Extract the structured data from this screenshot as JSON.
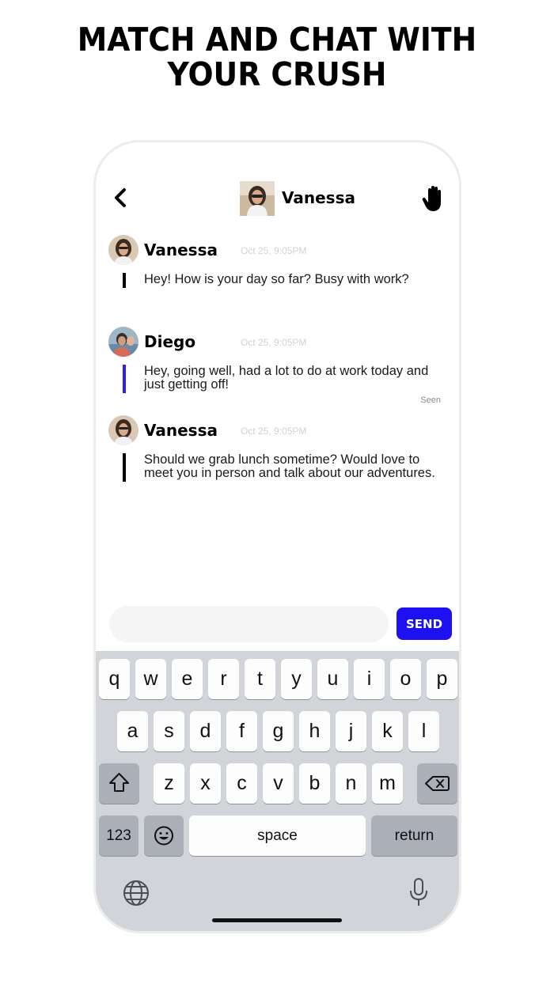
{
  "headline": {
    "line1": "MATCH AND CHAT WITH",
    "line2": "YOUR CRUSH"
  },
  "chat": {
    "contact_name": "Vanessa",
    "messages": [
      {
        "sender": "Vanessa",
        "time": "Oct 25, 9:05PM",
        "text": "Hey! How is your day so far? Busy with work?",
        "accent": "#000000"
      },
      {
        "sender": "Diego",
        "time": "Oct 25, 9:05PM",
        "text": "Hey, going well, had a lot to do at work today and just getting off!",
        "accent": "#2d1ff5",
        "status": "Seen"
      },
      {
        "sender": "Vanessa",
        "time": "Oct 25, 9:05PM",
        "text": "Should we grab lunch sometime? Would love to meet you in person and talk about our adventures.",
        "accent": "#000000"
      }
    ]
  },
  "composer": {
    "placeholder": "",
    "send_label": "SEND",
    "send_color": "#1d11f2"
  },
  "keyboard": {
    "row1": [
      "q",
      "w",
      "e",
      "r",
      "t",
      "y",
      "u",
      "i",
      "o",
      "p"
    ],
    "row2": [
      "a",
      "s",
      "d",
      "f",
      "g",
      "h",
      "j",
      "k",
      "l"
    ],
    "row3": [
      "z",
      "x",
      "c",
      "v",
      "b",
      "n",
      "m"
    ],
    "numbers_label": "123",
    "space_label": "space",
    "return_label": "return",
    "icons": [
      "shift-icon",
      "backspace-icon",
      "emoji-icon",
      "globe-icon",
      "microphone-icon"
    ]
  },
  "icons": {
    "back": "chevron-left-icon",
    "block": "hand-stop-icon"
  }
}
